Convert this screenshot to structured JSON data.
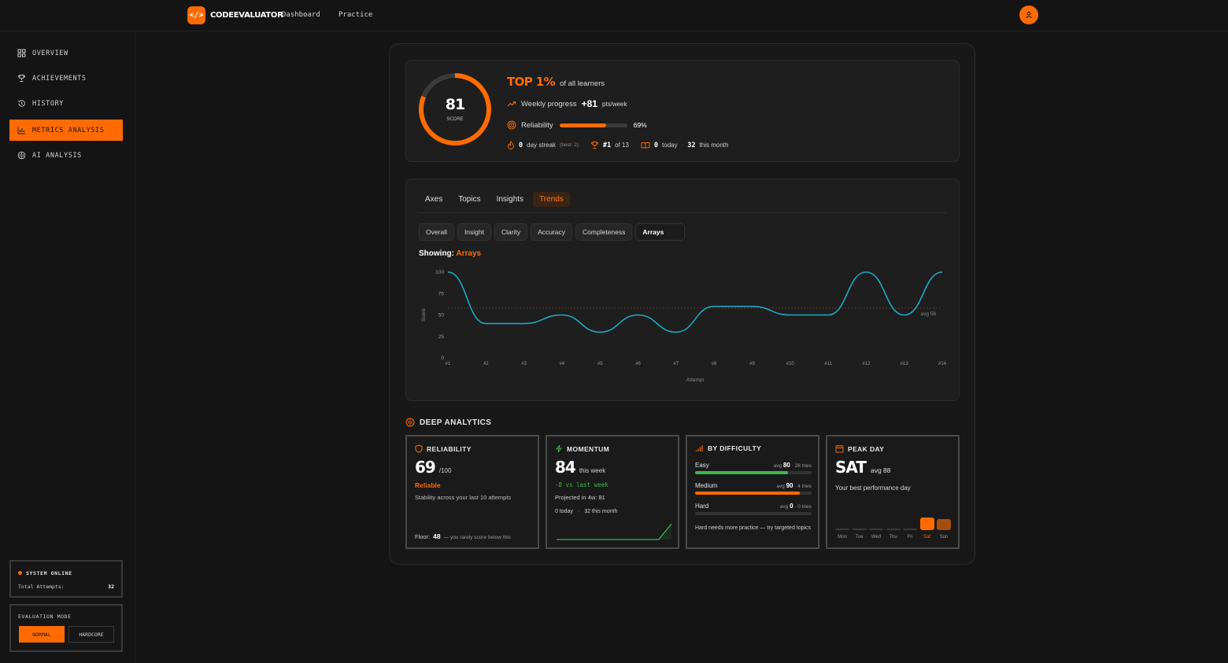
{
  "app": {
    "name": "CODEEVALUATOR",
    "logo_glyph": "</>",
    "nav": [
      "Dashboard",
      "Practice"
    ]
  },
  "sidebar": {
    "items": [
      {
        "label": "OVERVIEW",
        "icon": "grid-icon"
      },
      {
        "label": "ACHIEVEMENTS",
        "icon": "trophy-icon"
      },
      {
        "label": "HISTORY",
        "icon": "history-icon"
      },
      {
        "label": "METRICS ANALYSIS",
        "icon": "bar-chart-icon",
        "active": true
      },
      {
        "label": "AI ANALYSIS",
        "icon": "brain-icon"
      }
    ],
    "system": {
      "status": "SYSTEM ONLINE",
      "attempts_label": "Total Attempts:",
      "attempts_value": "32"
    },
    "mode": {
      "title": "EVALUATION MODE",
      "normal": "NORMAL",
      "hardcore": "HARDCORE",
      "selected": "NORMAL"
    }
  },
  "summary": {
    "score": "81",
    "score_label": "SCORE",
    "score_fraction": 0.81,
    "top_rank": "TOP 1%",
    "top_suffix": "of all learners",
    "weekly_label": "Weekly progress",
    "weekly_value": "+81",
    "weekly_unit": "pts/week",
    "reliability_label": "Reliability",
    "reliability_value": "69%",
    "reliability_fraction": 0.69,
    "streak_value": "0",
    "streak_label": "day streak",
    "streak_best": "(best: 2)",
    "rank_value": "#1",
    "rank_label": "of 13",
    "today_value": "0",
    "today_label": "today",
    "month_value": "32",
    "month_label": "this month"
  },
  "trends": {
    "tabs": [
      "Axes",
      "Topics",
      "Insights",
      "Trends"
    ],
    "active_tab": "Trends",
    "pills": [
      "Overall",
      "Insight",
      "Clarity",
      "Accuracy",
      "Completeness",
      "Arrays"
    ],
    "active_pill": "Arrays",
    "showing_label": "Showing:",
    "showing_value": "Arrays"
  },
  "chart_data": {
    "type": "line",
    "x": [
      "#1",
      "#2",
      "#3",
      "#4",
      "#5",
      "#6",
      "#7",
      "#8",
      "#9",
      "#10",
      "#11",
      "#12",
      "#13",
      "#14"
    ],
    "series": [
      {
        "values": [
          100,
          40,
          40,
          50,
          30,
          50,
          30,
          60,
          60,
          50,
          50,
          100,
          50,
          100
        ]
      }
    ],
    "xlabel": "Attempt",
    "ylabel": "Score",
    "ylim": [
      0,
      100
    ],
    "yticks": [
      0,
      25,
      50,
      75,
      100
    ],
    "average": 58,
    "average_label": "avg 58",
    "line_color": "#1fa8c0",
    "avg_color": "#5a3a2a",
    "grid": false
  },
  "deep_analytics": {
    "title": "DEEP ANALYTICS",
    "reliability": {
      "title": "RELIABILITY",
      "value": "69",
      "unit": "/100",
      "status": "Reliable",
      "desc": "Stability across your last 10 attempts",
      "floor_label": "Floor:",
      "floor_value": "48",
      "floor_desc": "— you rarely score below this"
    },
    "momentum": {
      "title": "MOMENTUM",
      "value": "84",
      "unit": "this week",
      "delta": "-8 vs last week",
      "projected": "Projected in 4w: 81",
      "today": "0 today",
      "month": "32 this month",
      "spark": [
        0,
        0,
        0,
        0,
        0,
        0,
        0,
        0,
        0,
        84
      ]
    },
    "difficulty": {
      "title": "BY DIFFICULTY",
      "rows": [
        {
          "name": "Easy",
          "avg_label": "avg",
          "avg": "80",
          "tries": "28 tries",
          "fraction": 0.8,
          "color": "#3fb950"
        },
        {
          "name": "Medium",
          "avg_label": "avg",
          "avg": "90",
          "tries": "4 tries",
          "fraction": 0.9,
          "color": "#ff6b00"
        },
        {
          "name": "Hard",
          "avg_label": "avg",
          "avg": "0",
          "tries": "0 tries",
          "fraction": 0,
          "color": "#e04040"
        }
      ],
      "note": "Hard needs more practice — try targeted topics"
    },
    "peak": {
      "title": "PEAK DAY",
      "day": "SAT",
      "avg": "avg 88",
      "desc": "Your best performance day",
      "days": [
        "Mon",
        "Tue",
        "Wed",
        "Thu",
        "Fri",
        "Sat",
        "Sun"
      ],
      "levels": [
        0.05,
        0.05,
        0.05,
        0.05,
        0.05,
        1.0,
        0.85
      ],
      "peak_index": 5
    }
  },
  "colors": {
    "accent": "#ff6b00",
    "green": "#3fb950",
    "cyan": "#1fa8c0"
  }
}
